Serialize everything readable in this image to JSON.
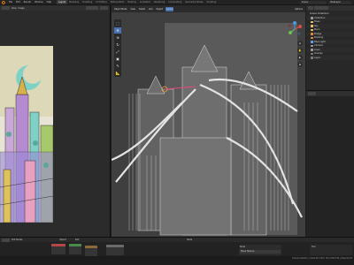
{
  "menu": {
    "items": [
      "File",
      "Edit",
      "Render",
      "Window",
      "Help"
    ],
    "workspaces": [
      "Layout",
      "Modeling",
      "Sculpting",
      "UV Editing",
      "Texture Paint",
      "Shading",
      "Animation",
      "Rendering",
      "Compositing",
      "Geometry Nodes",
      "Scripting"
    ],
    "active_workspace": "Layout",
    "scene": "Scene",
    "view_layer": "ViewLayer"
  },
  "image_editor": {
    "header": [
      "View",
      "Image"
    ]
  },
  "viewport": {
    "header": [
      "Object Mode",
      "View",
      "Select",
      "Add",
      "Object"
    ],
    "mode_button": "Global",
    "shading_label": "Options"
  },
  "outliner": {
    "title": "Scene Collection",
    "rows": [
      {
        "label": "Collection",
        "color": "#9a9a9a"
      },
      {
        "label": "Trees",
        "color": "#e6c36a"
      },
      {
        "label": "Sky",
        "color": "#e6c36a"
      },
      {
        "label": "Moon",
        "color": "#e6c36a"
      },
      {
        "label": "Bridge",
        "color": "#e08a3c"
      },
      {
        "label": "Building",
        "color": "#e08a3c"
      },
      {
        "label": "Blue Light",
        "color": "#6a9be6"
      },
      {
        "label": "Camera",
        "color": "#9a9a9a"
      },
      {
        "label": "Lines",
        "color": "#9a9a9a"
      },
      {
        "label": "Overlay",
        "color": "#7a7a7a"
      },
      {
        "label": "Layer",
        "color": "#7a7a7a"
      }
    ]
  },
  "bottom": {
    "labels": [
      "Slot Nodes",
      "Object",
      "Slot",
      "Node"
    ],
    "tool_name": "Move Texture",
    "right_labels": [
      "Node",
      "Tool"
    ]
  },
  "status": {
    "text": "Scene Collection | Verts 917,302 | Tris 1,812,574 | Objects 0/3"
  },
  "colors": {
    "accent": "#4772b3",
    "moon": "#f2f2f2"
  }
}
